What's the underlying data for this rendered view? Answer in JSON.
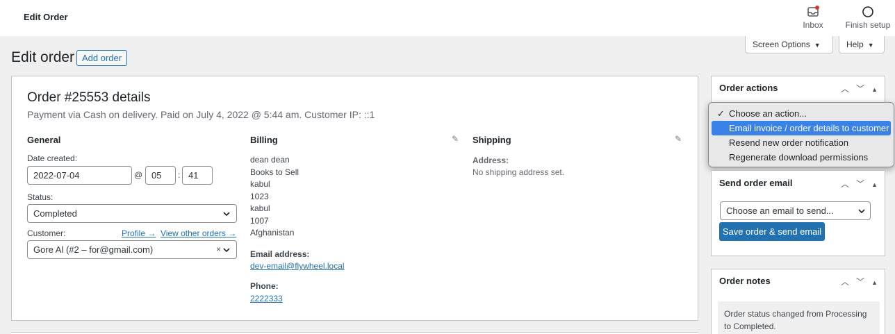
{
  "topbar": {
    "title": "Edit Order",
    "inbox_label": "Inbox",
    "setup_label": "Finish setup"
  },
  "tabs": {
    "screen_options": "Screen Options",
    "help": "Help"
  },
  "page": {
    "title": "Edit order",
    "add_button": "Add order"
  },
  "order": {
    "heading": "Order #25553 details",
    "subtitle": "Payment via Cash on delivery. Paid on July 4, 2022 @ 5:44 am. Customer IP: ::1"
  },
  "general": {
    "heading": "General",
    "date_label": "Date created:",
    "date_value": "2022-07-04",
    "at": "@",
    "hour": "05",
    "colon": ":",
    "minute": "41",
    "status_label": "Status:",
    "status_value": "Completed",
    "customer_label": "Customer:",
    "profile_link": "Profile →",
    "other_orders_link": "View other orders →",
    "customer_value": "Gore Al (#2 – for@gmail.com)",
    "clear": "×"
  },
  "billing": {
    "heading": "Billing",
    "lines": [
      "dean dean",
      "Books to Sell",
      "kabul",
      "1023",
      "kabul",
      "1007",
      "Afghanistan"
    ],
    "email_label": "Email address:",
    "email_value": "dev-email@flywheel.local",
    "phone_label": "Phone:",
    "phone_value": "2222333"
  },
  "shipping": {
    "heading": "Shipping",
    "address_label": "Address:",
    "address_value": "No shipping address set."
  },
  "order_actions": {
    "heading": "Order actions",
    "options": [
      "Choose an action...",
      "Email invoice / order details to customer",
      "Resend new order notification",
      "Regenerate download permissions"
    ],
    "checked_mark": "✓"
  },
  "send_email": {
    "heading": "Send order email",
    "select_value": "Choose an email to send...",
    "button": "Save order & send email"
  },
  "order_notes": {
    "heading": "Order notes",
    "note": "Order status changed from Processing to Completed."
  },
  "colors": {
    "accent": "#2271b1",
    "highlight": "#3b82e8",
    "notice_dot": "#d63638"
  }
}
